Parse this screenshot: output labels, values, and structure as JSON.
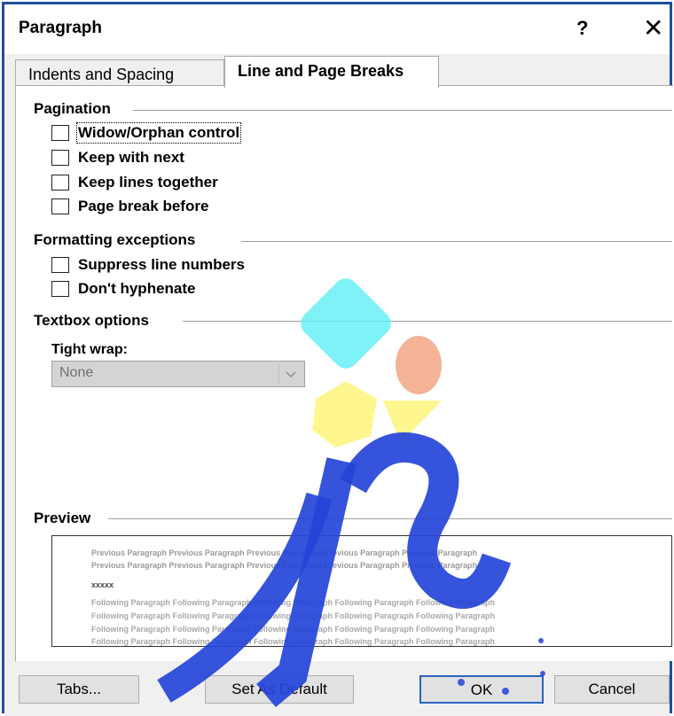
{
  "window": {
    "title": "Paragraph",
    "help_label": "?",
    "close_label": "✕"
  },
  "tabs": [
    {
      "label": "Indents and Spacing",
      "active": false
    },
    {
      "label": "Line and Page Breaks",
      "active": true
    }
  ],
  "pagination": {
    "heading": "Pagination",
    "items": [
      {
        "label": "Widow/Orphan control",
        "checked": false,
        "focused": true
      },
      {
        "label": "Keep with next",
        "checked": false
      },
      {
        "label": "Keep lines together",
        "checked": false
      },
      {
        "label": "Page break before",
        "checked": false
      }
    ]
  },
  "formatting_exceptions": {
    "heading": "Formatting exceptions",
    "items": [
      {
        "label": "Suppress line numbers",
        "checked": false
      },
      {
        "label": "Don't hyphenate",
        "checked": false
      }
    ]
  },
  "textbox_options": {
    "heading": "Textbox options",
    "tight_wrap_label": "Tight wrap:",
    "tight_wrap_value": "None"
  },
  "preview": {
    "heading": "Preview",
    "previous_lines": [
      "Previous Paragraph Previous Paragraph Previous Paragraph Previous Paragraph Previous Paragraph",
      "Previous Paragraph Previous Paragraph Previous Paragraph Previous Paragraph Previous Paragraph"
    ],
    "sample": "xxxxx",
    "following_lines": [
      "Following Paragraph Following Paragraph Following Paragraph Following Paragraph Following Paragraph",
      "Following Paragraph Following Paragraph Following Paragraph Following Paragraph Following Paragraph",
      "Following Paragraph Following Paragraph Following Paragraph Following Paragraph Following Paragraph",
      "Following Paragraph Following Paragraph Following Paragraph Following Paragraph Following Paragraph"
    ]
  },
  "buttons": {
    "tabs": "Tabs...",
    "set_default": "Set As Default",
    "ok": "OK",
    "cancel": "Cancel"
  },
  "colors": {
    "frame_border": "#1f4f9a",
    "ok_border": "#2a64c0",
    "watermark_blue": "#2444d8",
    "watermark_cyan": "#5ff0f5",
    "watermark_yellow": "#fff574",
    "watermark_salmon": "#f2a07e"
  }
}
